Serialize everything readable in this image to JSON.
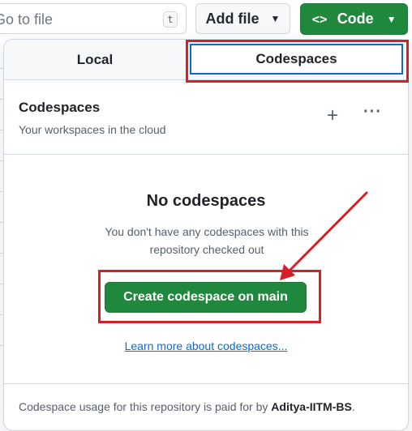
{
  "toolbar": {
    "goto_placeholder": "Go to file",
    "goto_shortcut": "t",
    "add_file_label": "Add file",
    "code_label": "Code",
    "code_icon": "<>",
    "caret_icon": "chevron-down-icon"
  },
  "dropdown": {
    "tabs": [
      {
        "label": "Local",
        "selected": false
      },
      {
        "label": "Codespaces",
        "selected": true
      }
    ],
    "header": {
      "title": "Codespaces",
      "subtitle": "Your workspaces in the cloud",
      "plus_icon": "+",
      "more_icon": "···"
    },
    "empty_state": {
      "title": "No codespaces",
      "description": "You don't have any codespaces with this repository checked out",
      "create_button_label": "Create codespace on main",
      "learn_more_label": "Learn more about codespaces..."
    },
    "footer": {
      "text_prefix": "Codespace usage for this repository is paid for by ",
      "owner": "Aditya-IITM-BS",
      "text_suffix": "."
    }
  },
  "colors": {
    "primary_green": "#1f883d",
    "link_blue": "#0969da",
    "annotation_red": "#d61f26"
  }
}
